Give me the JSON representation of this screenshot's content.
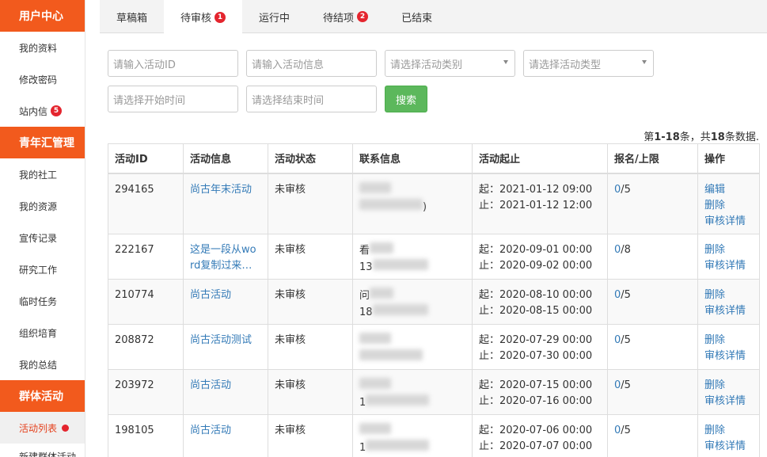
{
  "sidebar": {
    "sections": [
      {
        "title": "用户中心",
        "items": [
          {
            "label": "我的资料",
            "badge": ""
          },
          {
            "label": "修改密码",
            "badge": ""
          },
          {
            "label": "站内信",
            "badge": "5"
          }
        ]
      },
      {
        "title": "青年汇管理",
        "items": [
          {
            "label": "我的社工",
            "badge": ""
          },
          {
            "label": "我的资源",
            "badge": ""
          },
          {
            "label": "宣传记录",
            "badge": ""
          },
          {
            "label": "研究工作",
            "badge": ""
          },
          {
            "label": "临时任务",
            "badge": ""
          },
          {
            "label": "组织培育",
            "badge": ""
          },
          {
            "label": "我的总结",
            "badge": ""
          }
        ]
      },
      {
        "title": "群体活动",
        "items": [
          {
            "label": "活动列表",
            "badge": "",
            "active": true,
            "dot": true
          },
          {
            "label": "新建群体活动",
            "badge": ""
          }
        ]
      }
    ]
  },
  "tabs": [
    {
      "label": "草稿箱",
      "badge": ""
    },
    {
      "label": "待审核",
      "badge": "1",
      "active": true
    },
    {
      "label": "运行中",
      "badge": ""
    },
    {
      "label": "待结项",
      "badge": "2"
    },
    {
      "label": "已结束",
      "badge": ""
    }
  ],
  "filters": {
    "activity_id_placeholder": "请输入活动ID",
    "activity_info_placeholder": "请输入活动信息",
    "category_placeholder": "请选择活动类别",
    "type_placeholder": "请选择活动类型",
    "start_time_placeholder": "请选择开始时间",
    "end_time_placeholder": "请选择结束时间",
    "search_label": "搜索"
  },
  "summary": {
    "prefix": "第",
    "range": "1-18",
    "mid": "条，共",
    "total": "18",
    "suffix": "条数据."
  },
  "table": {
    "headers": [
      "活动ID",
      "活动信息",
      "活动状态",
      "联系信息",
      "活动起止",
      "报名/上限",
      "操作"
    ],
    "rows": [
      {
        "id": "294165",
        "info": "尚古年末活动",
        "status": "未审核",
        "contact1": "",
        "contact2": ")",
        "start": "起：2021-01-12 09:00",
        "end": "止：2021-01-12 12:00",
        "enrolled": "0",
        "limit": "/5",
        "actions": [
          "编辑",
          "删除",
          "审核详情"
        ]
      },
      {
        "id": "222167",
        "info": "这是一段从wo rd复制过来…",
        "status": "未审核",
        "contact1": "看",
        "contact2": "13",
        "start": "起：2020-09-01 00:00",
        "end": "止：2020-09-02 00:00",
        "enrolled": "0",
        "limit": "/8",
        "actions": [
          "删除",
          "审核详情"
        ]
      },
      {
        "id": "210774",
        "info": "尚古活动",
        "status": "未审核",
        "contact1": "问",
        "contact2": "18",
        "start": "起：2020-08-10 00:00",
        "end": "止：2020-08-15 00:00",
        "enrolled": "0",
        "limit": "/5",
        "actions": [
          "删除",
          "审核详情"
        ]
      },
      {
        "id": "208872",
        "info": "尚古活动测试",
        "status": "未审核",
        "contact1": "",
        "contact2": "",
        "start": "起：2020-07-29 00:00",
        "end": "止：2020-07-30 00:00",
        "enrolled": "0",
        "limit": "/5",
        "actions": [
          "删除",
          "审核详情"
        ]
      },
      {
        "id": "203972",
        "info": "尚古活动",
        "status": "未审核",
        "contact1": "",
        "contact2": "1",
        "start": "起：2020-07-15 00:00",
        "end": "止：2020-07-16 00:00",
        "enrolled": "0",
        "limit": "/5",
        "actions": [
          "删除",
          "审核详情"
        ]
      },
      {
        "id": "198105",
        "info": "尚古活动",
        "status": "未审核",
        "contact1": "",
        "contact2": "1",
        "start": "起：2020-07-06 00:00",
        "end": "止：2020-07-07 00:00",
        "enrolled": "0",
        "limit": "/5",
        "actions": [
          "删除",
          "审核详情"
        ]
      }
    ]
  },
  "colors": {
    "brand": "#f25a1d",
    "link": "#337ab7",
    "badge": "#e4252e",
    "search": "#5cb85c"
  }
}
